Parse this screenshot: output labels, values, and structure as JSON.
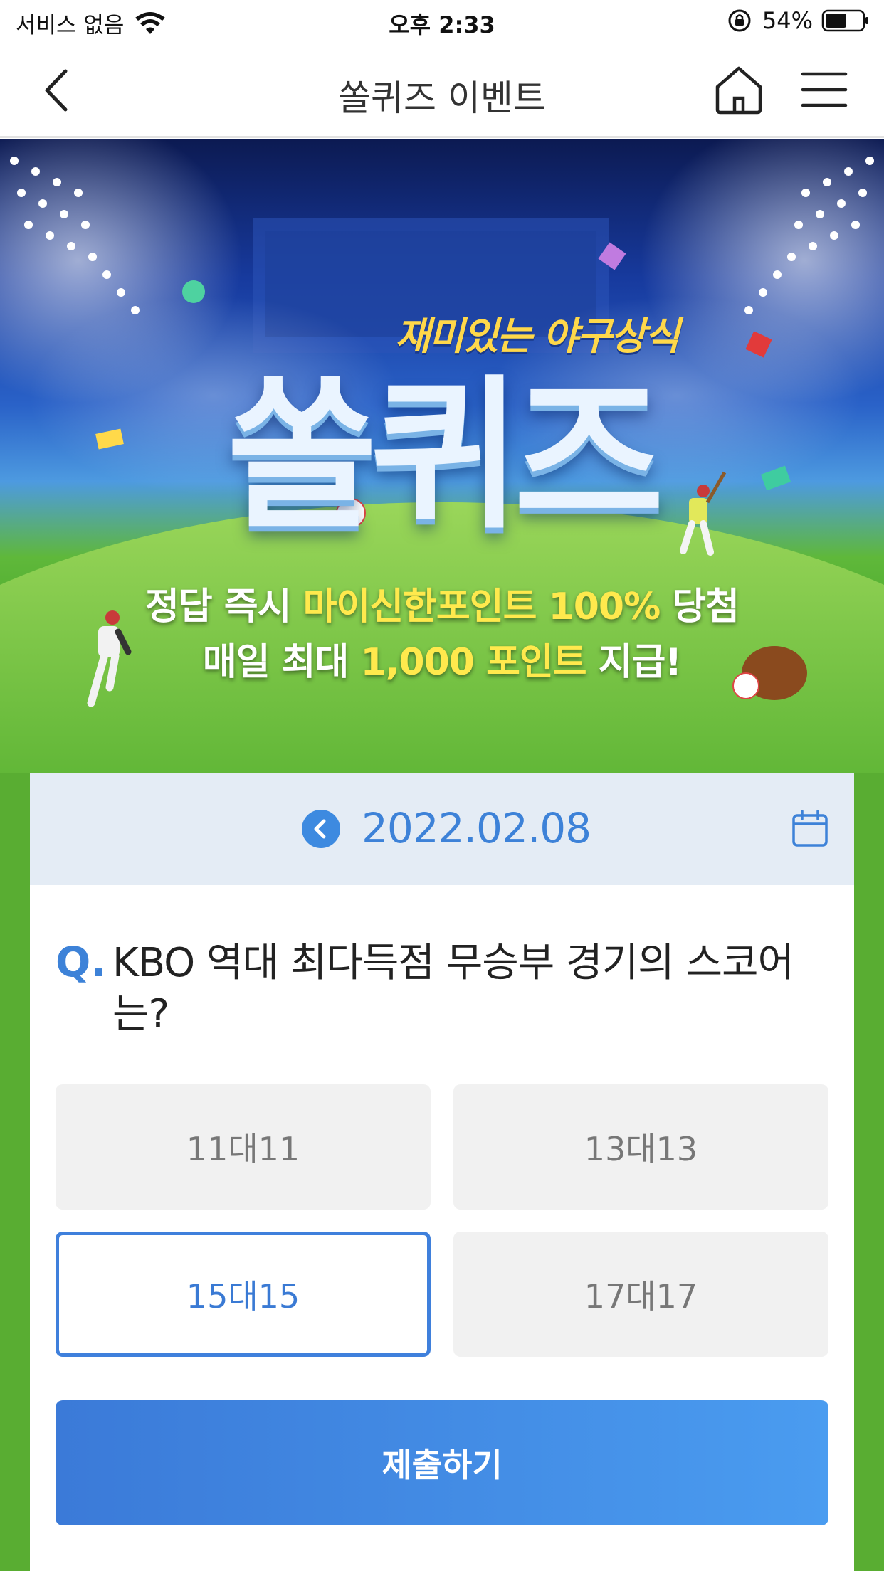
{
  "status_bar": {
    "carrier": "서비스 없음",
    "time": "오후 2:33",
    "battery": "54%"
  },
  "nav": {
    "title": "쏠퀴즈 이벤트",
    "back_icon": "chevron-left-icon",
    "home_icon": "home-icon",
    "menu_icon": "hamburger-menu-icon"
  },
  "banner": {
    "subtitle": "재미있는 야구상식",
    "title": "쏠퀴즈",
    "line1_prefix": "정답 즉시 ",
    "line1_highlight": "마이신한포인트 100%",
    "line1_suffix": " 당첨",
    "line2_prefix": "매일 최대 ",
    "line2_highlight": "1,000 포인트",
    "line2_suffix": " 지급!"
  },
  "quiz": {
    "date": "2022.02.08",
    "question_mark": "Q.",
    "question": "KBO 역대 최다득점 무승부 경기의 스코어는?",
    "options": [
      {
        "label": "11대11"
      },
      {
        "label": "13대13"
      },
      {
        "label": "15대15"
      },
      {
        "label": "17대17"
      }
    ],
    "selected_option": "15대15",
    "submit_label": "제출하기"
  },
  "colors": {
    "accent": "#3d82d8",
    "field_green": "#59ad32",
    "highlight_yellow": "#ffe94d"
  }
}
